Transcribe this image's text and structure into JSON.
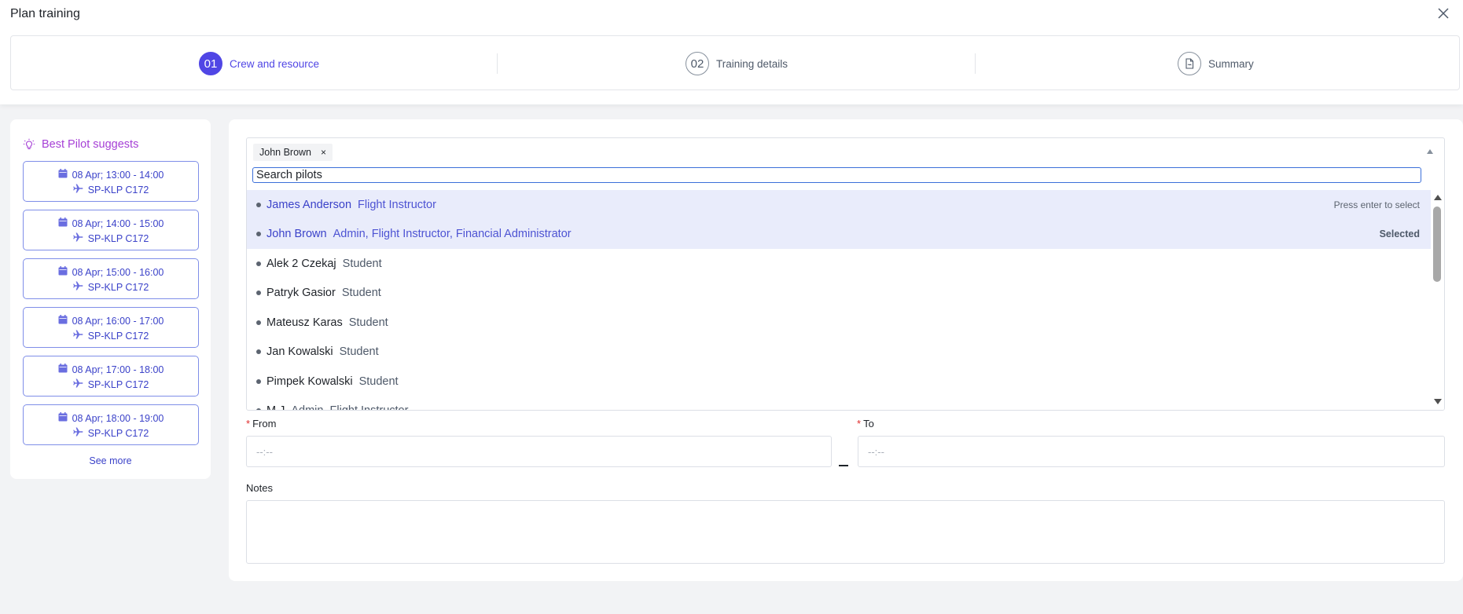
{
  "dialog": {
    "title": "Plan training"
  },
  "steps": [
    {
      "number": "01",
      "label": "Crew and resource"
    },
    {
      "number": "02",
      "label": "Training details"
    },
    {
      "label": "Summary"
    }
  ],
  "suggestions": {
    "heading": "Best Pilot suggests",
    "slots": [
      {
        "time": "08 Apr; 13:00 - 14:00",
        "aircraft": "SP-KLP C172"
      },
      {
        "time": "08 Apr; 14:00 - 15:00",
        "aircraft": "SP-KLP C172"
      },
      {
        "time": "08 Apr; 15:00 - 16:00",
        "aircraft": "SP-KLP C172"
      },
      {
        "time": "08 Apr; 16:00 - 17:00",
        "aircraft": "SP-KLP C172"
      },
      {
        "time": "08 Apr; 17:00 - 18:00",
        "aircraft": "SP-KLP C172"
      },
      {
        "time": "08 Apr; 18:00 - 19:00",
        "aircraft": "SP-KLP C172"
      }
    ],
    "see_more": "See more"
  },
  "pilot_select": {
    "selected_tag": "John Brown",
    "tag_remove": "×",
    "search_placeholder": "Search pilots",
    "hint_enter": "Press enter to select",
    "hint_selected": "Selected",
    "options": [
      {
        "name": "James Anderson",
        "role": "Flight Instructor"
      },
      {
        "name": "John Brown",
        "role": "Admin, Flight Instructor, Financial Administrator"
      },
      {
        "name": "Alek 2 Czekaj",
        "role": "Student"
      },
      {
        "name": "Patryk Gasior",
        "role": "Student"
      },
      {
        "name": "Mateusz Karas",
        "role": "Student"
      },
      {
        "name": "Jan Kowalski",
        "role": "Student"
      },
      {
        "name": "Pimpek Kowalski",
        "role": "Student"
      },
      {
        "name": "M J",
        "role": "Admin, Flight Instructor"
      }
    ]
  },
  "form": {
    "required_mark": "*",
    "from_label": "From",
    "to_label": "To",
    "time_placeholder": "--:--",
    "notes_label": "Notes"
  },
  "colors": {
    "accent": "#5046e5",
    "suggest": "#a63fd6",
    "highlight": "#e9ecfb"
  }
}
